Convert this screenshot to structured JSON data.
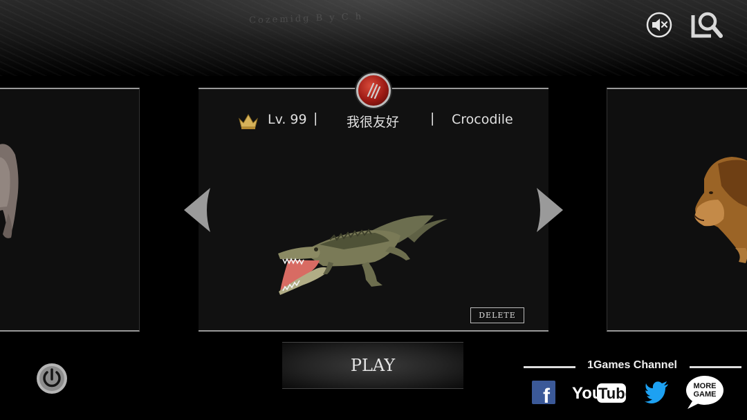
{
  "header": {
    "map_text": "Cozemidg B y C h",
    "mute_icon": "speaker-mute-icon",
    "search_icon": "search-icon"
  },
  "character": {
    "level": "Lv. 99",
    "separator": "|",
    "name": "我很友好",
    "species": "Crocodile",
    "rank_icon": "crown-icon",
    "badge_icon": "claw-badge-icon"
  },
  "carousel": {
    "left_animal": "hippo",
    "center_animal": "crocodile",
    "right_animal": "lion",
    "prev_icon": "chevron-left-icon",
    "next_icon": "chevron-right-icon"
  },
  "actions": {
    "delete_label": "DELETE",
    "play_label": "PLAY"
  },
  "social": {
    "channel_title": "1Games Channel",
    "facebook_label": "f",
    "youtube_you": "You",
    "youtube_tube": "Tube",
    "more_line1": "MORE",
    "more_line2": "GAME"
  },
  "colors": {
    "badge_red": "#9c1a14",
    "facebook_blue": "#3b5998",
    "twitter_blue": "#1da1f2"
  }
}
